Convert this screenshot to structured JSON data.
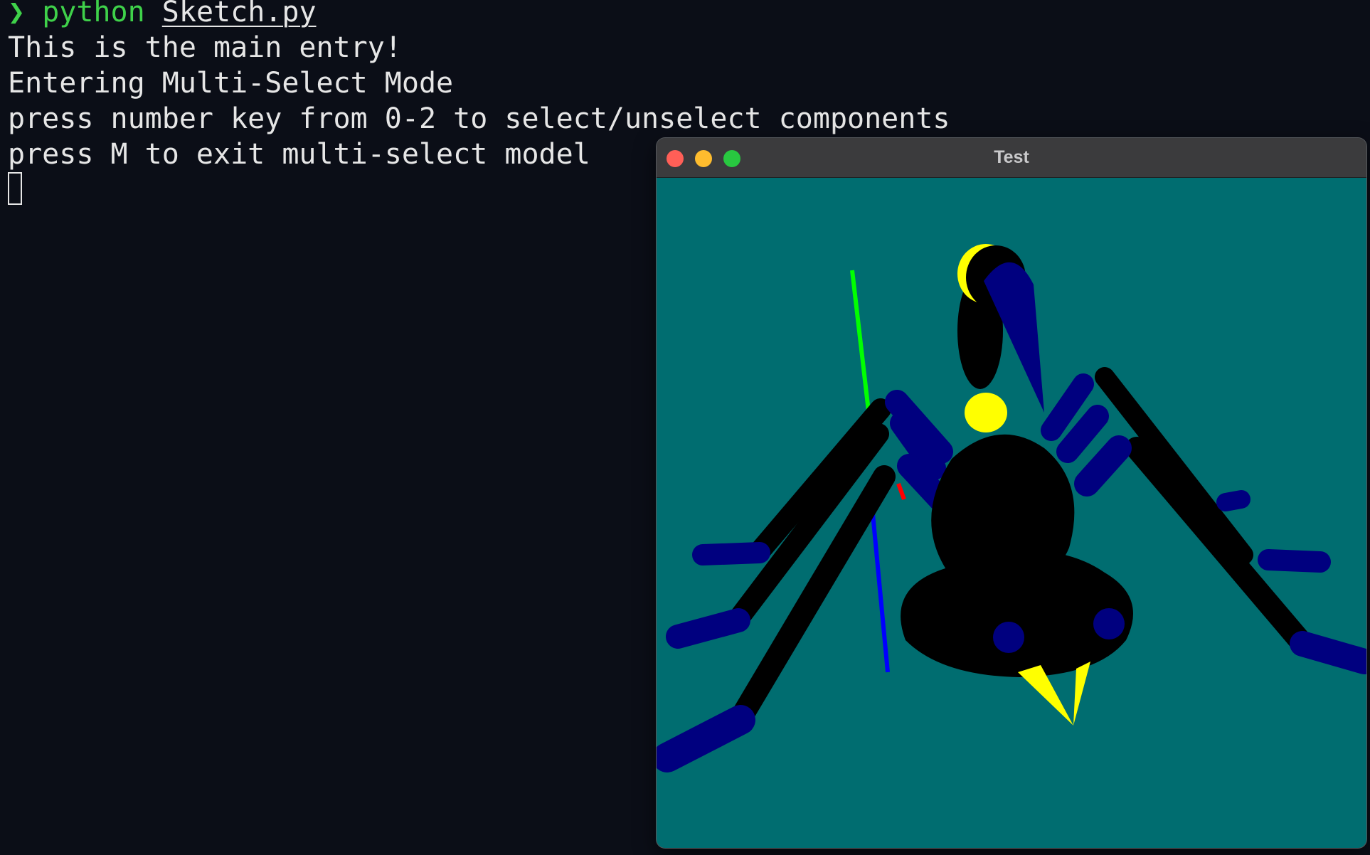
{
  "terminal": {
    "prompt_symbol": "❯",
    "command": "python",
    "argument": "Sketch.py",
    "output_lines": [
      "This is the main entry!",
      "Entering Multi-Select Mode",
      "press number key from 0-2 to select/unselect components",
      "press M to exit multi-select model"
    ]
  },
  "window": {
    "title": "Test",
    "canvas_background": "#006d70"
  },
  "colors": {
    "body": "#000000",
    "limb": "#00007f",
    "accent": "#ffff00",
    "axis_x": "#ff0000",
    "axis_y": "#00ff00",
    "axis_z": "#0000ff"
  }
}
